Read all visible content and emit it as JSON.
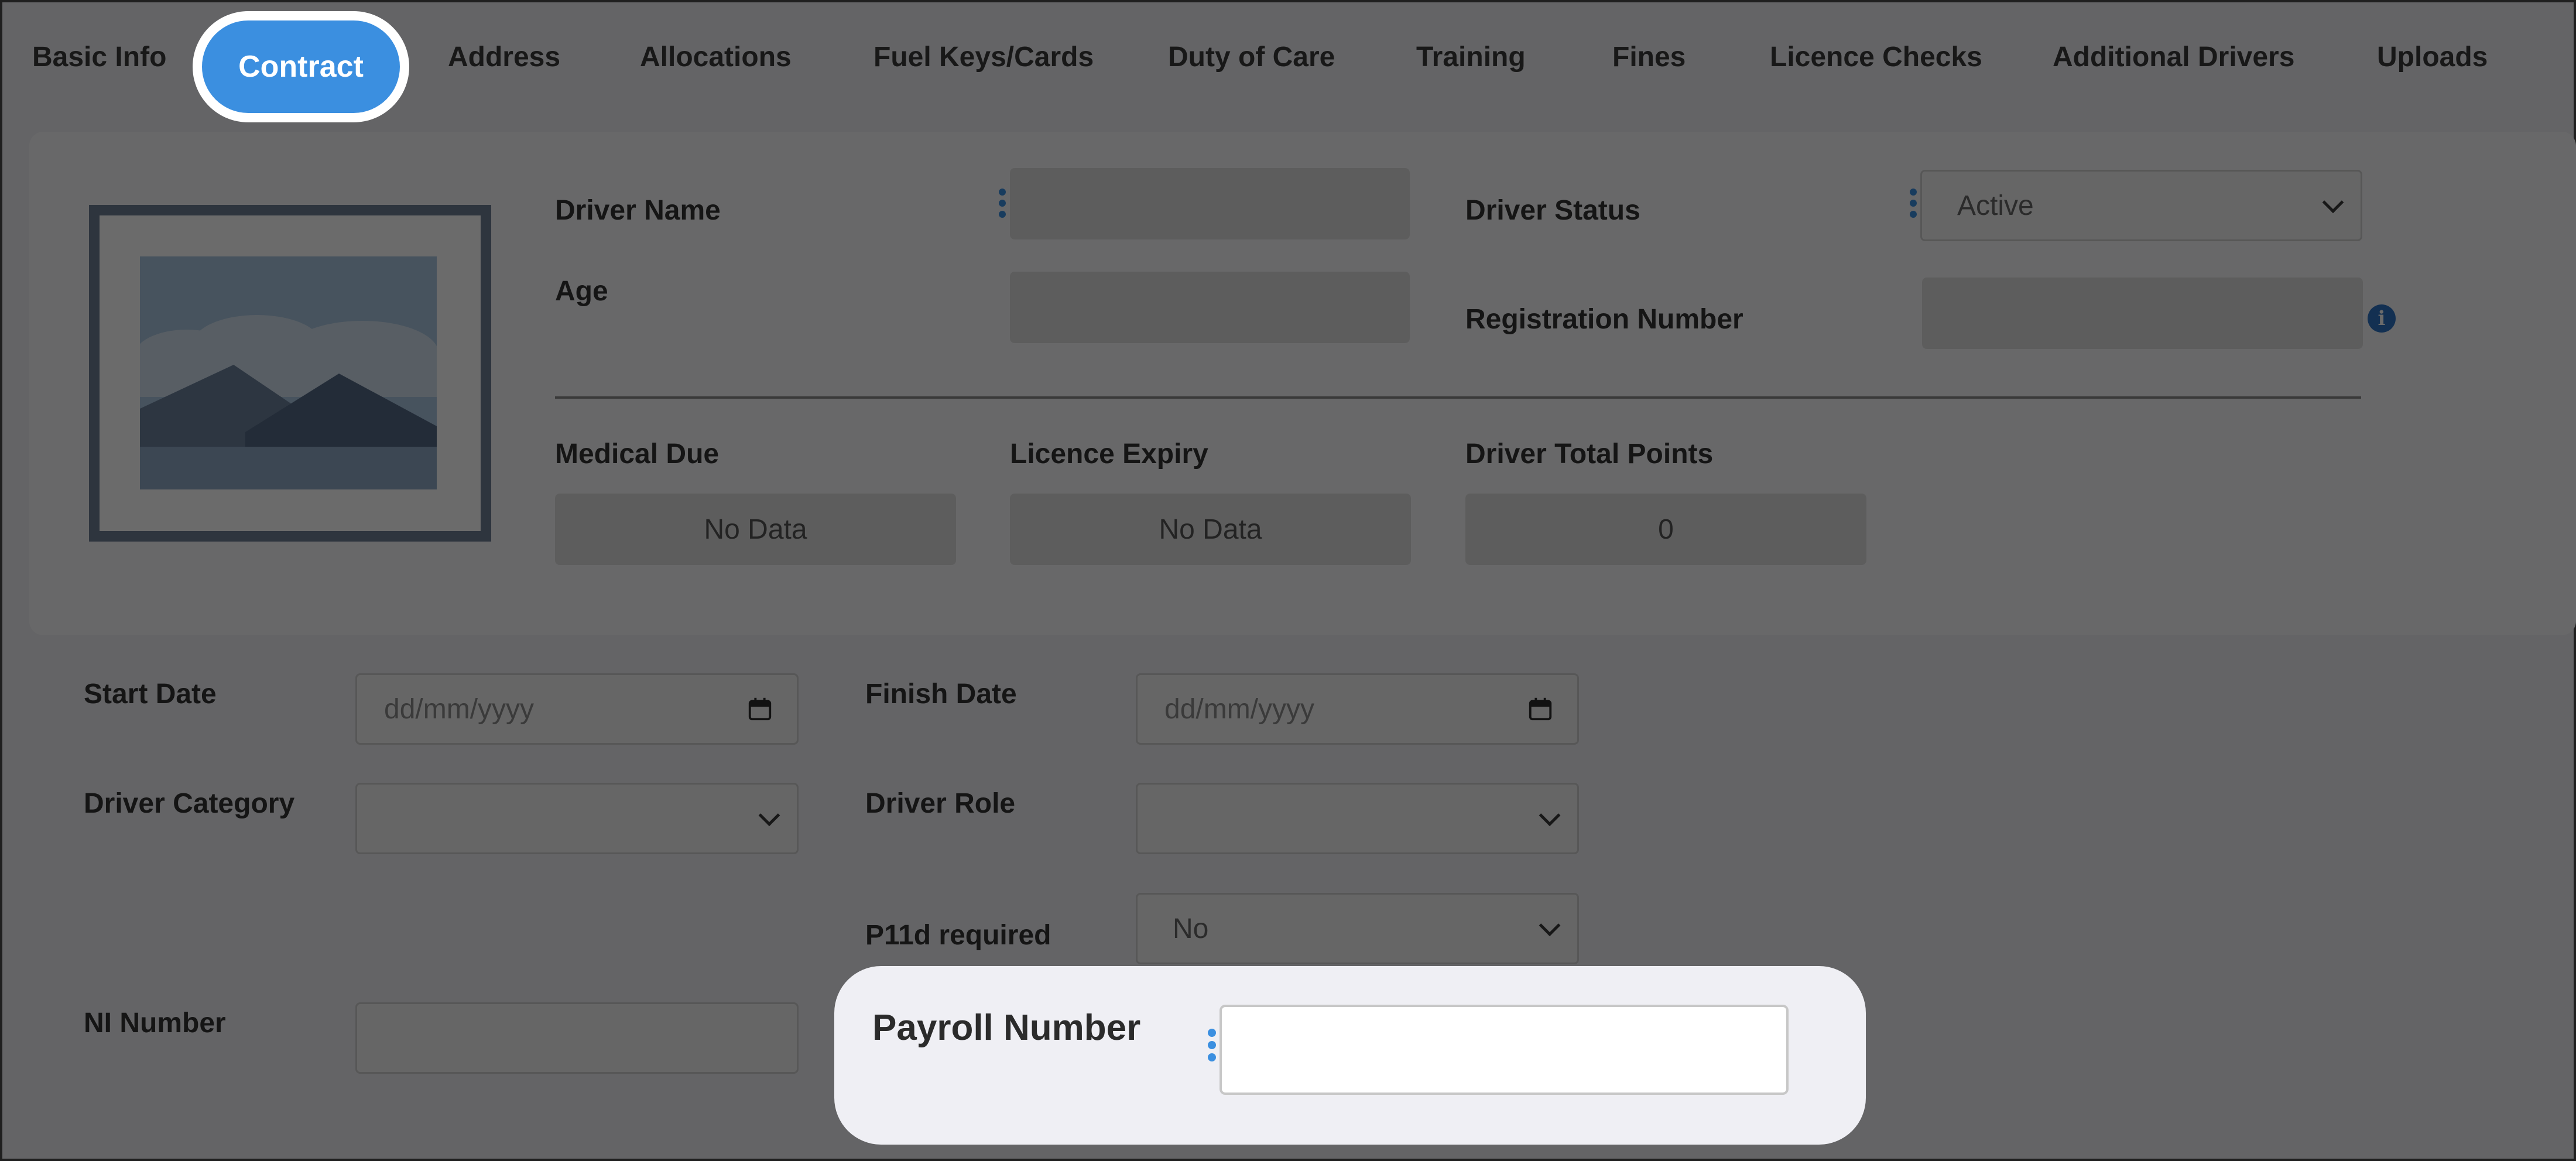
{
  "tabs": {
    "basic_info": "Basic Info",
    "contract": "Contract",
    "address": "Address",
    "allocations": "Allocations",
    "fuel": "Fuel Keys/Cards",
    "duty": "Duty of Care",
    "training": "Training",
    "fines": "Fines",
    "licence_checks": "Licence Checks",
    "additional_drivers": "Additional Drivers",
    "uploads": "Uploads"
  },
  "profile": {
    "driver_name_label": "Driver Name",
    "driver_name_value": "",
    "age_label": "Age",
    "age_value": "",
    "driver_status_label": "Driver Status",
    "driver_status_value": "Active",
    "registration_label": "Registration Number",
    "registration_value": "",
    "medical_due_label": "Medical Due",
    "medical_due_value": "No Data",
    "licence_expiry_label": "Licence Expiry",
    "licence_expiry_value": "No Data",
    "total_points_label": "Driver Total Points",
    "total_points_value": "0"
  },
  "contract": {
    "start_date_label": "Start Date",
    "start_date_placeholder": "dd/mm/yyyy",
    "finish_date_label": "Finish Date",
    "finish_date_placeholder": "dd/mm/yyyy",
    "driver_category_label": "Driver Category",
    "driver_category_value": "",
    "driver_role_label": "Driver Role",
    "driver_role_value": "",
    "p11d_label": "P11d required",
    "p11d_value": "No",
    "ni_number_label": "NI Number",
    "ni_number_value": "",
    "payroll_label": "Payroll Number",
    "payroll_value": ""
  },
  "icons": {
    "calendar": "calendar-icon",
    "chevron": "chevron-down-icon",
    "info": "info-icon",
    "drag": "drag-handle-icon",
    "photo": "image-placeholder-icon"
  },
  "colors": {
    "accent": "#3b8fe0",
    "overlay": "rgba(0,0,0,0.58)"
  }
}
